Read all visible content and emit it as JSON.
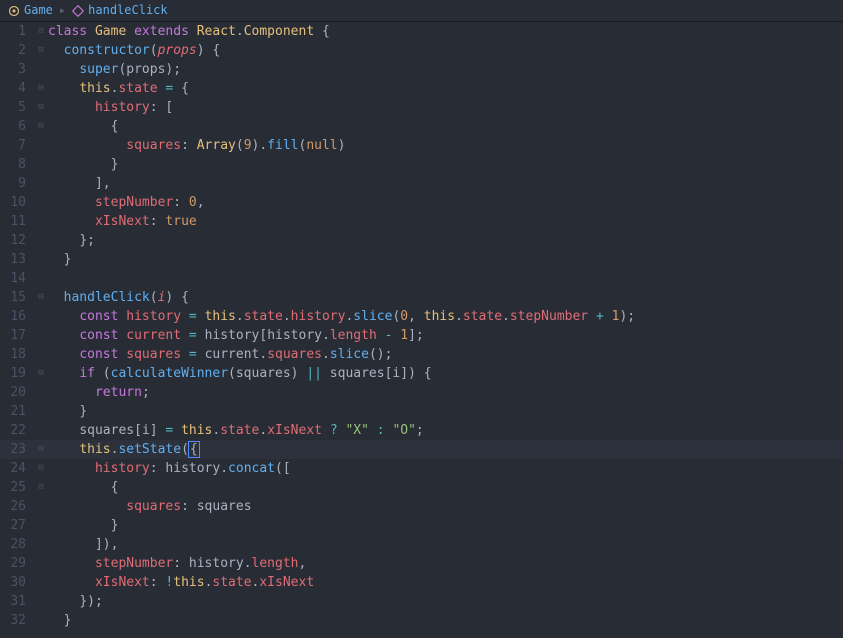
{
  "breadcrumb": {
    "item1": "Game",
    "item2": "handleClick"
  },
  "gutter": {
    "l1": "1",
    "l2": "2",
    "l3": "3",
    "l4": "4",
    "l5": "5",
    "l6": "6",
    "l7": "7",
    "l8": "8",
    "l9": "9",
    "l10": "10",
    "l11": "11",
    "l12": "12",
    "l13": "13",
    "l14": "14",
    "l15": "15",
    "l16": "16",
    "l17": "17",
    "l18": "18",
    "l19": "19",
    "l20": "20",
    "l21": "21",
    "l22": "22",
    "l23": "23",
    "l24": "24",
    "l25": "25",
    "l26": "26",
    "l27": "27",
    "l28": "28",
    "l29": "29",
    "l30": "30",
    "l31": "31",
    "l32": "32"
  },
  "fold": {
    "open": "⊟",
    "none": ""
  },
  "tokens": {
    "class": "class",
    "extends": "extends",
    "constructor": "constructor",
    "const": "const",
    "if": "if",
    "return": "return",
    "Game": "Game",
    "React": "React",
    "Component": "Component",
    "props": "props",
    "super": "super",
    "this": "this",
    "state": "state",
    "history": "history",
    "squares": "squares",
    "Array": "Array",
    "fill": "fill",
    "null": "null",
    "stepNumber": "stepNumber",
    "xIsNext": "xIsNext",
    "true": "true",
    "handleClick": "handleClick",
    "i": "i",
    "slice": "slice",
    "current": "current",
    "length": "length",
    "calculateWinner": "calculateWinner",
    "setState": "setState",
    "concat": "concat",
    "X": "\"X\"",
    "O": "\"O\"",
    "n0": "0",
    "n1": "1",
    "n9": "9",
    "plus": "+",
    "minus": "-",
    "eq": "=",
    "eqeq": "=",
    "colon": ":",
    "semi": ";",
    "comma": ",",
    "lbrace": "{",
    "rbrace": "}",
    "lparen": "(",
    "rparen": ")",
    "lbrack": "[",
    "rbrack": "]",
    "dot": ".",
    "or": "||",
    "bang": "!",
    "q": "?"
  },
  "code_plain": [
    "class Game extends React.Component {",
    "  constructor(props) {",
    "    super(props);",
    "    this.state = {",
    "      history: [",
    "        {",
    "          squares: Array(9).fill(null)",
    "        }",
    "      ],",
    "      stepNumber: 0,",
    "      xIsNext: true",
    "    };",
    "  }",
    "",
    "  handleClick(i) {",
    "    const history = this.state.history.slice(0, this.state.stepNumber + 1);",
    "    const current = history[history.length - 1];",
    "    const squares = current.squares.slice();",
    "    if (calculateWinner(squares) || squares[i]) {",
    "      return;",
    "    }",
    "    squares[i] = this.state.xIsNext ? \"X\" : \"O\";",
    "    this.setState({",
    "      history: history.concat([",
    "        {",
    "          squares: squares",
    "        }",
    "      ]),",
    "      stepNumber: history.length,",
    "      xIsNext: !this.state.xIsNext",
    "    });",
    "  }"
  ]
}
